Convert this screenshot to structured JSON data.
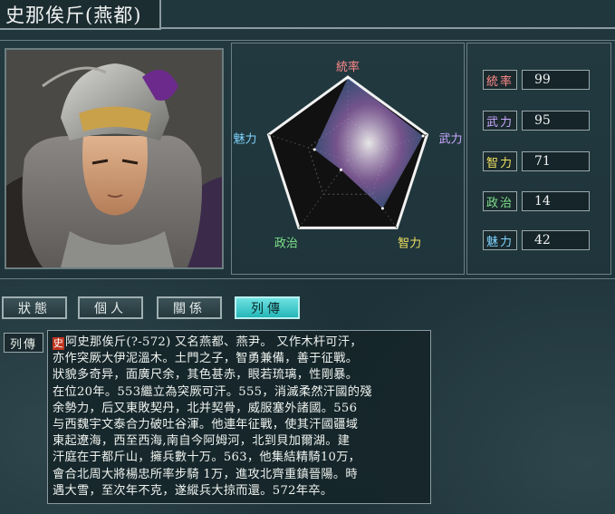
{
  "title": "史那俟斤(燕都)",
  "stats": [
    {
      "label": "統率",
      "value": "99",
      "color": "#ff8a8a"
    },
    {
      "label": "武力",
      "value": "95",
      "color": "#c9a8ff"
    },
    {
      "label": "智力",
      "value": "71",
      "color": "#f0e060"
    },
    {
      "label": "政治",
      "value": "14",
      "color": "#7ee08a"
    },
    {
      "label": "魅力",
      "value": "42",
      "color": "#7fd4ff"
    }
  ],
  "radar": {
    "axes": [
      "統率",
      "武力",
      "智力",
      "政治",
      "魅力"
    ],
    "values": [
      99,
      95,
      71,
      14,
      42
    ],
    "max": 100
  },
  "tabs": [
    {
      "label": "狀態",
      "active": false
    },
    {
      "label": "個人",
      "active": false
    },
    {
      "label": "關係",
      "active": false
    },
    {
      "label": "列傳",
      "active": true
    }
  ],
  "bio": {
    "label": "列傳",
    "mark": "史",
    "text": "阿史那俟斤(?-572) 又名燕都、燕尹。 又作木杆可汗，\n亦作突厥大伊泥溫木。土門之子，智勇兼備，善于征戰。\n狀貌多奇异，面廣尺余，其色甚赤，眼若琉璃，性剛暴。\n在位20年。553繼立為突厥可汗。555，消滅柔然汗國的殘\n余勢力，后又東敗契丹，北并契骨，威服塞外諸國。556\n与西魏宇文泰合力破吐谷渾。他連年征戰，使其汗國疆域\n東起遼海，西至西海,南自今阿姆河，北到貝加爾湖。建\n汗庭在于都斤山，擁兵數十万。563，他集結精騎10万，\n會合北周大將楊忠所率步騎 1万，進攻北齊重鎮晉陽。時\n遇大雪，至次年不克，遂縱兵大掠而還。572年卒。"
  }
}
